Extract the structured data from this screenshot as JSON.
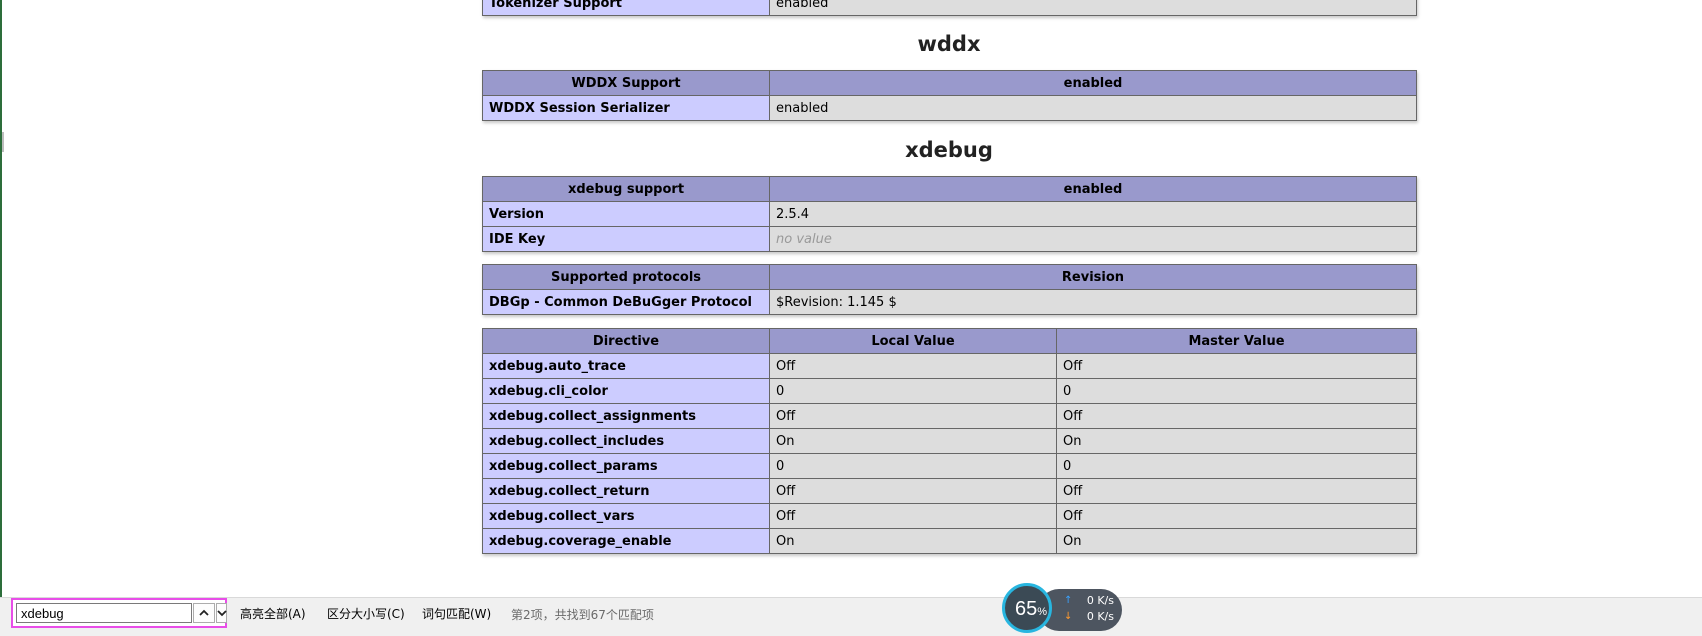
{
  "top_partial": {
    "label": "Tokenizer Support",
    "value": "enabled"
  },
  "sections": {
    "wddx": {
      "title": "wddx",
      "header": [
        "WDDX Support",
        "enabled"
      ],
      "rows": [
        {
          "label": "WDDX Session Serializer",
          "value": "enabled"
        }
      ]
    },
    "xdebug": {
      "title": "xdebug",
      "support_header": [
        "xdebug support",
        "enabled"
      ],
      "info_rows": [
        {
          "label": "Version",
          "value": "2.5.4"
        },
        {
          "label": "IDE Key",
          "value": "no value"
        }
      ],
      "protocols_header": [
        "Supported protocols",
        "Revision"
      ],
      "protocol_rows": [
        {
          "label": "DBGp - Common DeBuGger Protocol",
          "value": "$Revision: 1.145 $"
        }
      ],
      "directive_headers": [
        "Directive",
        "Local Value",
        "Master Value"
      ],
      "directives": [
        {
          "name": "xdebug.auto_trace",
          "local": "Off",
          "master": "Off"
        },
        {
          "name": "xdebug.cli_color",
          "local": "0",
          "master": "0"
        },
        {
          "name": "xdebug.collect_assignments",
          "local": "Off",
          "master": "Off"
        },
        {
          "name": "xdebug.collect_includes",
          "local": "On",
          "master": "On"
        },
        {
          "name": "xdebug.collect_params",
          "local": "0",
          "master": "0"
        },
        {
          "name": "xdebug.collect_return",
          "local": "Off",
          "master": "Off"
        },
        {
          "name": "xdebug.collect_vars",
          "local": "Off",
          "master": "Off"
        },
        {
          "name": "xdebug.coverage_enable",
          "local": "On",
          "master": "On"
        }
      ]
    }
  },
  "find_bar": {
    "query": "xdebug",
    "highlight_all": "高亮全部(A)",
    "match_case": "区分大小写(C)",
    "whole_word": "词句匹配(W)",
    "status": "第2项，共找到67个匹配项"
  },
  "speed_widget": {
    "percent": "65",
    "percent_unit": "%",
    "upload": "0 K/s",
    "download": "0 K/s"
  },
  "colors": {
    "header_bg": "#9999cc",
    "label_bg": "#ccccff",
    "value_bg": "#dddddd",
    "find_highlight_border": "#e84de8"
  }
}
